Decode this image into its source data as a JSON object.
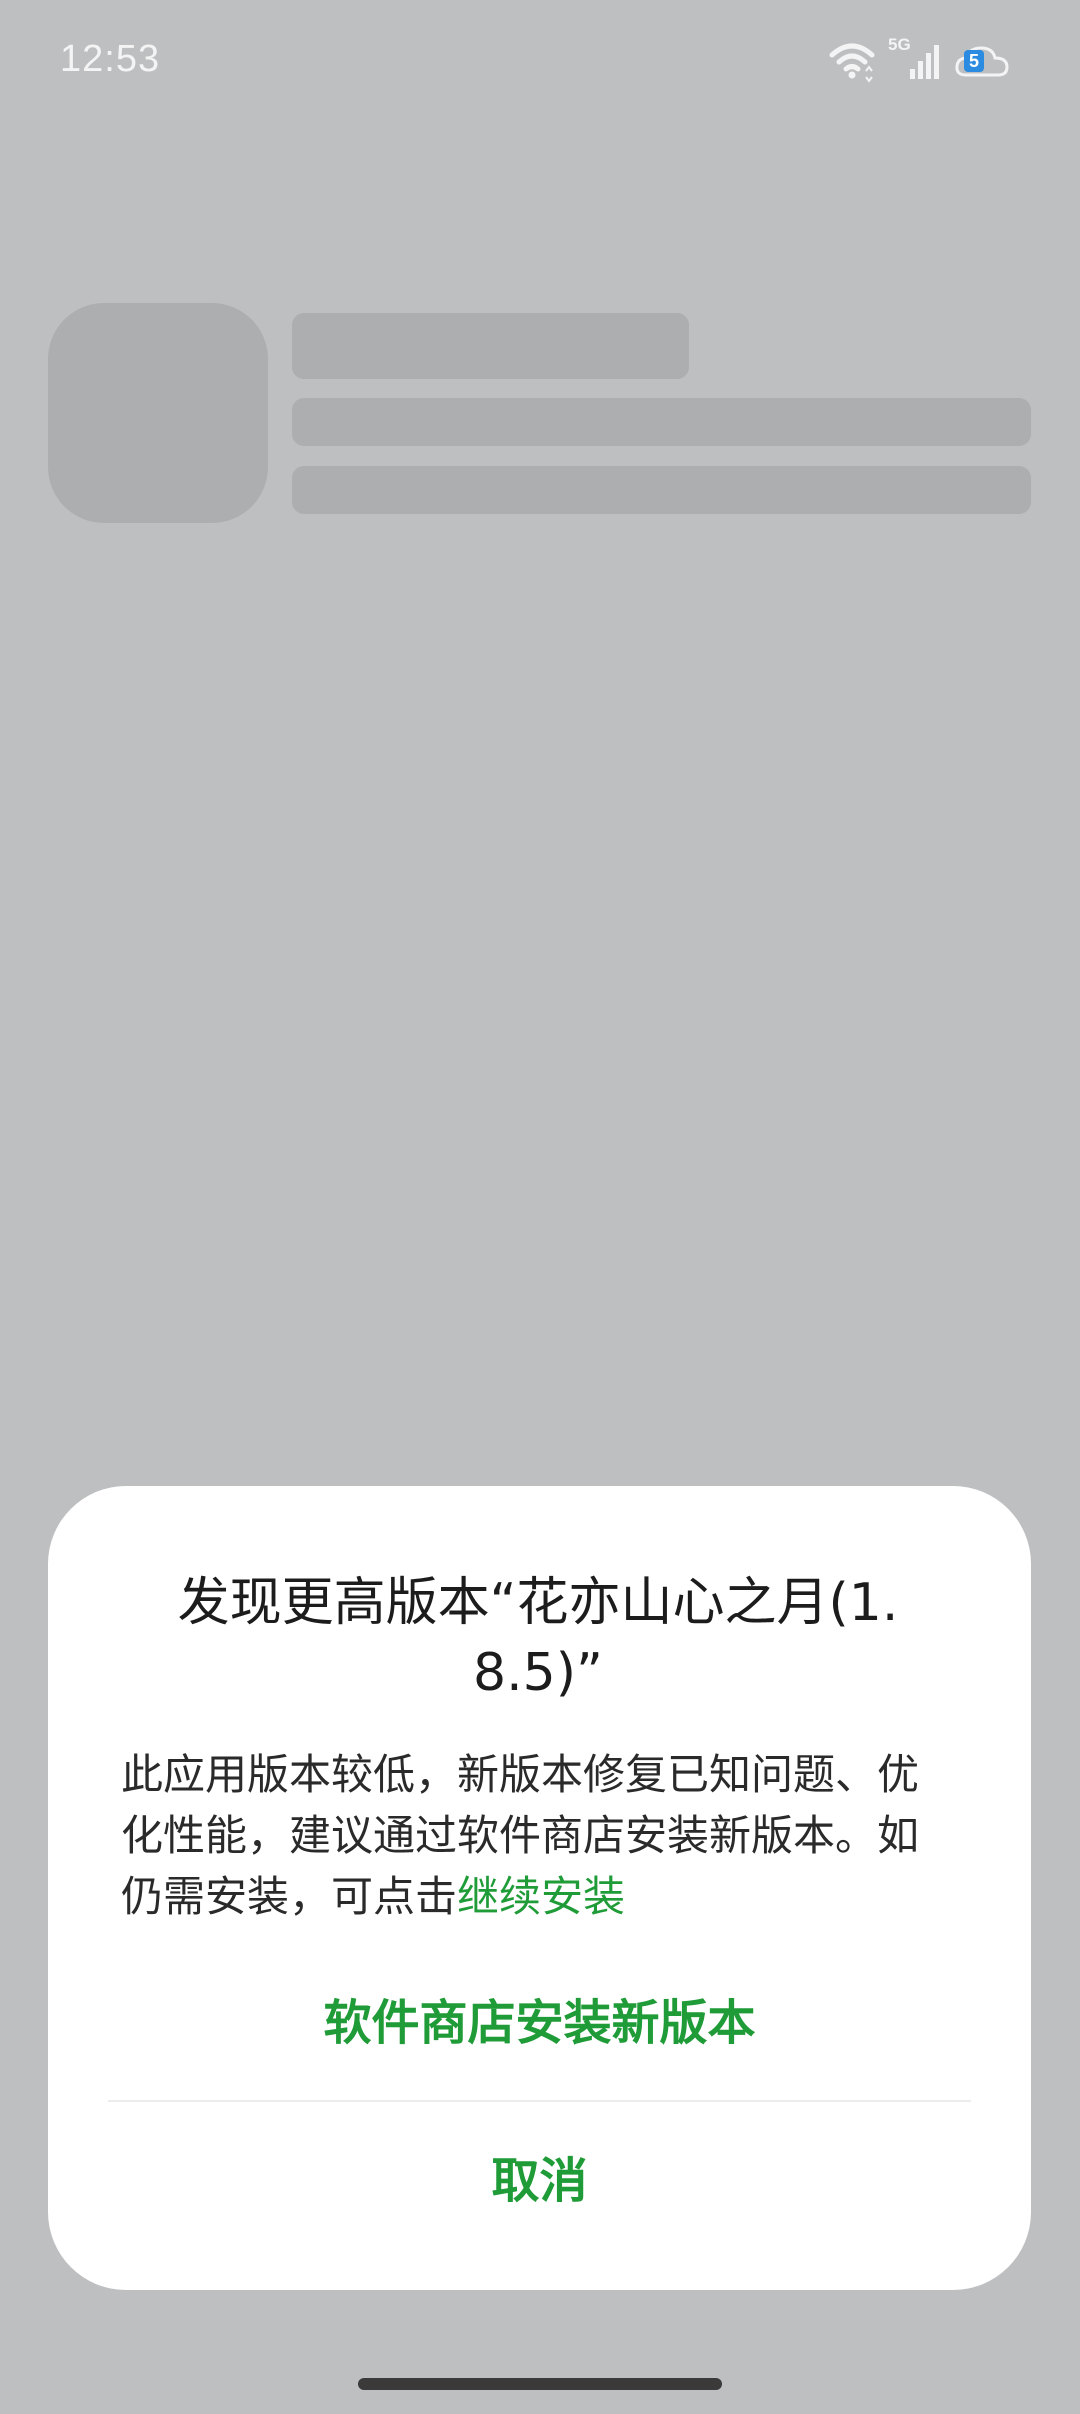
{
  "status_bar": {
    "time": "12:53",
    "network_label": "5G",
    "cloud_badge": "5"
  },
  "icons": {
    "wifi": "wifi-icon",
    "signal": "signal-icon",
    "cloud": "cloud-icon"
  },
  "dialog": {
    "title": "发现更高版本“花亦山心之月(1.8.5)”",
    "message_text": "此应用版本较低，新版本修复已知问题、优化性能，建议通过软件商店安装新版本。如仍需安装，可点击",
    "continue_link": "继续安装",
    "primary_button": "软件商店安装新版本",
    "cancel_button": "取消"
  },
  "colors": {
    "accent": "#1f9b37",
    "overlay": "#bebfc1",
    "skeleton": "#adaeaf"
  }
}
